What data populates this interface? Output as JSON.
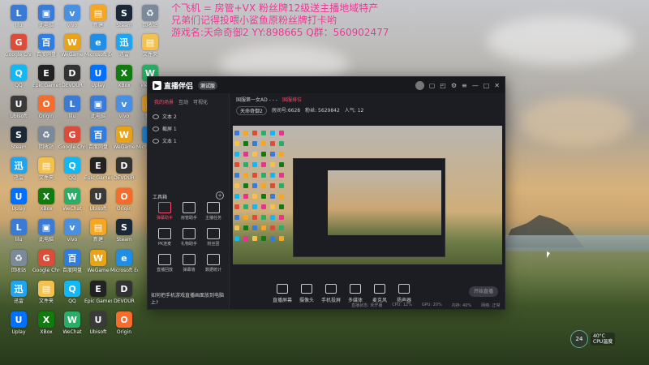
{
  "overlay": {
    "line1": "个飞机 = 房管+VX 粉丝牌12级送主播地域特产",
    "line2": "兄弟们记得投喂小鲨鱼原粉丝牌打卡哟",
    "line3": "游戏名:天命奇御2 YY:898665 Q群：560902477"
  },
  "desktop_icons": [
    {
      "label": "lilu",
      "color": "#3a7bd5",
      "glyph": "L"
    },
    {
      "label": "此电脑",
      "color": "#3a7bd5",
      "glyph": "▣"
    },
    {
      "label": "vivo",
      "color": "#4a90e2",
      "glyph": "v"
    },
    {
      "label": "新建",
      "color": "#f5a623",
      "glyph": "▤"
    },
    {
      "label": "Steam",
      "color": "#1b2838",
      "glyph": "S"
    },
    {
      "label": "回收站",
      "color": "#7a8a9a",
      "glyph": "♻"
    },
    {
      "label": "Google Chrome",
      "color": "#dd4b39",
      "glyph": "G"
    },
    {
      "label": "百度网盘",
      "color": "#2f7de1",
      "glyph": "百"
    },
    {
      "label": "WeGame",
      "color": "#e8a317",
      "glyph": "W"
    },
    {
      "label": "Microsoft Edge",
      "color": "#1f8ee6",
      "glyph": "e"
    },
    {
      "label": "迅雷",
      "color": "#1ea4f0",
      "glyph": "迅"
    },
    {
      "label": "文件夹",
      "color": "#f2c14e",
      "glyph": "▤"
    },
    {
      "label": "QQ",
      "color": "#12b7f5",
      "glyph": "Q"
    },
    {
      "label": "Epic Games",
      "color": "#222",
      "glyph": "E"
    },
    {
      "label": "DEVOUR",
      "color": "#333",
      "glyph": "D"
    },
    {
      "label": "Uplay",
      "color": "#0070ff",
      "glyph": "U"
    },
    {
      "label": "XBox",
      "color": "#107c10",
      "glyph": "X"
    },
    {
      "label": "WeChat",
      "color": "#2aae67",
      "glyph": "W"
    },
    {
      "label": "Ubisoft",
      "color": "#3a3a3a",
      "glyph": "U"
    },
    {
      "label": "Origin",
      "color": "#f56c2d",
      "glyph": "O"
    }
  ],
  "app": {
    "brand": "直播伴侣",
    "version": "测试版",
    "left_tabs": [
      "我的场景",
      "互动",
      "可视化"
    ],
    "scenes": [
      "文本 2",
      "截屏 1",
      "文本 1"
    ],
    "tools_title": "工具箱",
    "tools": [
      {
        "label": "弹幕助手",
        "hot": true
      },
      {
        "label": "房管助手",
        "hot": false
      },
      {
        "label": "主播任务",
        "hot": false
      },
      {
        "label": "PK连麦",
        "hot": false
      },
      {
        "label": "礼物助手",
        "hot": false
      },
      {
        "label": "粉丝团",
        "hot": false
      },
      {
        "label": "直播回放",
        "hot": false
      },
      {
        "label": "弹幕墙",
        "hot": false
      },
      {
        "label": "数据统计",
        "hot": false
      }
    ],
    "notice": "如何把手机游戏直播画面放到电脑上?",
    "stream_title": "国服第一女AD - - -",
    "stream_tag": "国服排位",
    "category": "天命奇御2",
    "stream_fields": [
      "房间号:6628",
      "粉丝: 5629842",
      "人气: 12"
    ],
    "bottom_items": [
      "直播屏幕",
      "摄像头",
      "手机投屏",
      "多媒体",
      "麦克风",
      "扬声器"
    ],
    "start_label": "开始直播",
    "status": [
      "直播状态: 未开播",
      "CPU: 12%",
      "GPU: 20%",
      "内存: 40%",
      "网络: 正常"
    ]
  },
  "widget": {
    "number": "24",
    "temp": "40°C",
    "cpu": "CPU温度"
  }
}
